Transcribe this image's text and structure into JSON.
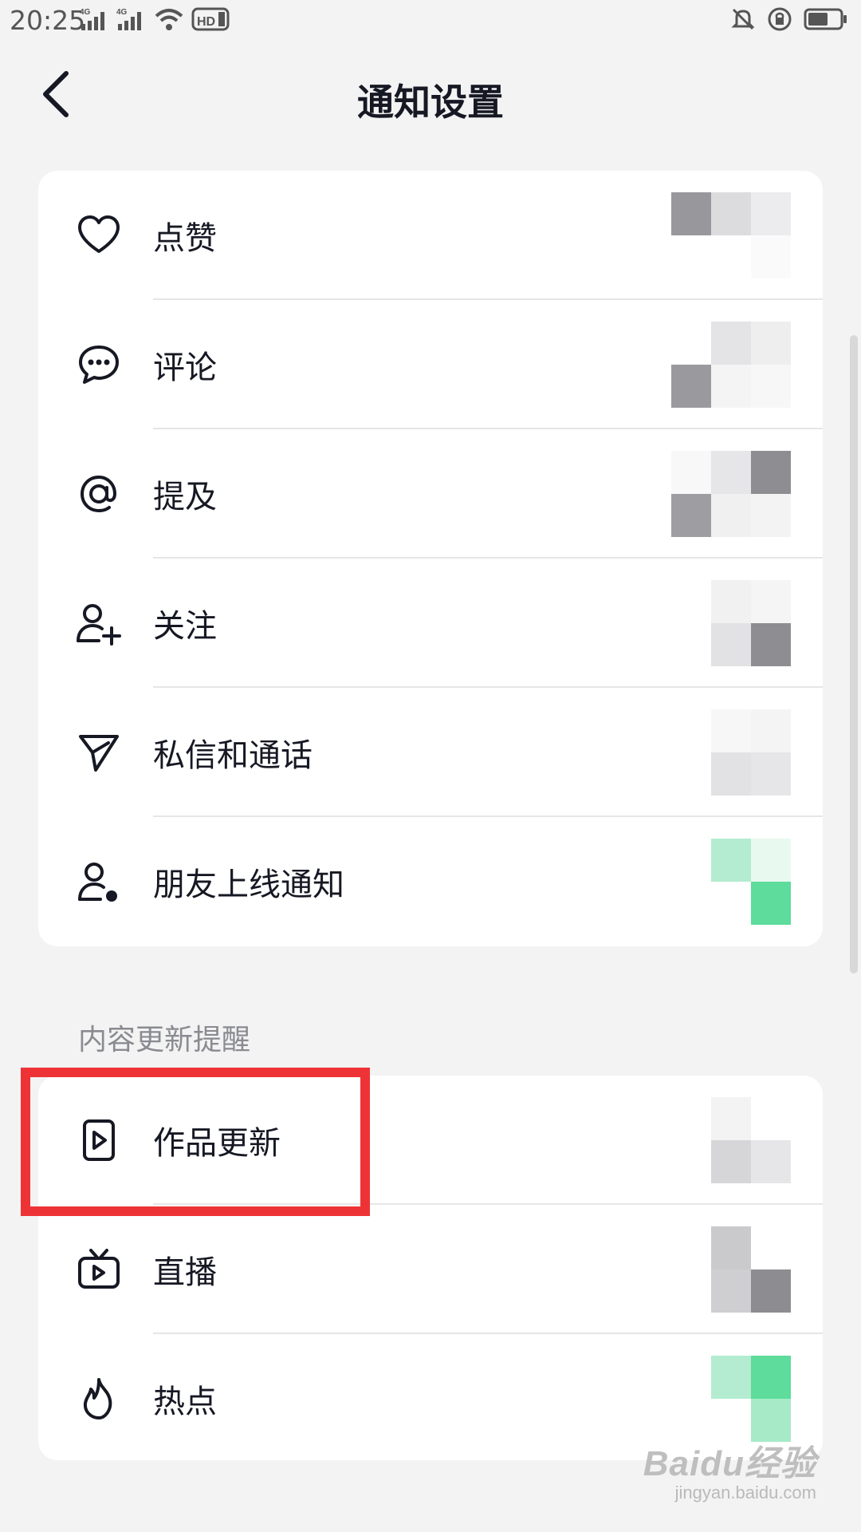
{
  "status_bar": {
    "time": "20:25",
    "signal_1": "4G",
    "signal_2": "4G",
    "hd_label": "HD",
    "icons": [
      "signal-icon",
      "signal-icon",
      "wifi-icon",
      "hd-icon",
      "mute-icon",
      "rotation-lock-icon",
      "battery-icon"
    ]
  },
  "header": {
    "title": "通知设置",
    "back_icon": "back-arrow-icon"
  },
  "group1": {
    "items": [
      {
        "label": "点赞",
        "icon": "heart-icon"
      },
      {
        "label": "评论",
        "icon": "comment-icon"
      },
      {
        "label": "提及",
        "icon": "at-icon"
      },
      {
        "label": "关注",
        "icon": "add-user-icon"
      },
      {
        "label": "私信和通话",
        "icon": "send-icon"
      },
      {
        "label": "朋友上线通知",
        "icon": "user-online-icon"
      }
    ]
  },
  "group2": {
    "title": "内容更新提醒",
    "items": [
      {
        "label": "作品更新",
        "icon": "video-icon"
      },
      {
        "label": "直播",
        "icon": "tv-icon"
      },
      {
        "label": "热点",
        "icon": "flame-icon"
      }
    ]
  },
  "colors": {
    "highlight": "#ee3336",
    "toggle_on": "#5ddc9b",
    "background": "#f3f3f3",
    "card": "#ffffff"
  },
  "watermark": {
    "main": "Baidu经验",
    "sub": "jingyan.baidu.com"
  }
}
